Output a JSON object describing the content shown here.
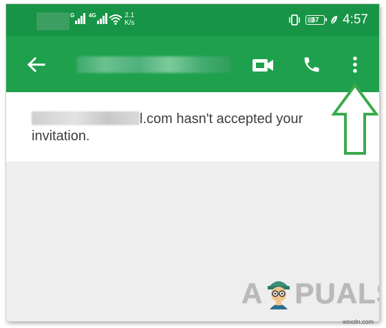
{
  "status_bar": {
    "sim1_label": "G",
    "sim2_label": "4G",
    "network_speed_value": "2.1",
    "network_speed_unit": "K/s",
    "battery_level": "37",
    "time": "4:57"
  },
  "toolbar": {
    "back_icon": "arrow-left-icon",
    "video_icon": "video-camera-icon",
    "call_icon": "phone-icon",
    "menu_icon": "more-vertical-icon"
  },
  "message": {
    "text_suffix": "l.com hasn't accepted your invitation."
  },
  "watermark": {
    "logo_left": "A",
    "logo_right": "PUALS",
    "site": "wsxdn.com"
  },
  "colors": {
    "status_bar": "#179446",
    "toolbar": "#1ea04d",
    "arrow": "#3aaa4a",
    "background": "#eeeeee"
  }
}
